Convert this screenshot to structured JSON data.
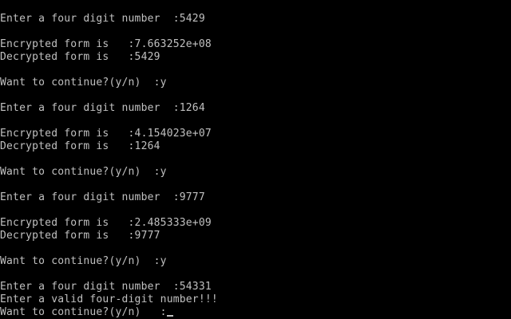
{
  "console": {
    "blocks": [
      {
        "prompt": "Enter a four digit number  :5429",
        "encrypted": "Encrypted form is   :7.663252e+08",
        "decrypted": "Decrypted form is   :5429",
        "continue": "Want to continue?(y/n)  :y"
      },
      {
        "prompt": "Enter a four digit number  :1264",
        "encrypted": "Encrypted form is   :4.154023e+07",
        "decrypted": "Decrypted form is   :1264",
        "continue": "Want to continue?(y/n)  :y"
      },
      {
        "prompt": "Enter a four digit number  :9777",
        "encrypted": "Encrypted form is   :2.485333e+09",
        "decrypted": "Decrypted form is   :9777",
        "continue": "Want to continue?(y/n)  :y"
      }
    ],
    "last": {
      "prompt": "Enter a four digit number  :54331",
      "error": "Enter a valid four-digit number!!!",
      "continue": "Want to continue?(y/n)   :"
    },
    "colors": {
      "background": "#000000",
      "text": "#c0c0c0"
    }
  }
}
